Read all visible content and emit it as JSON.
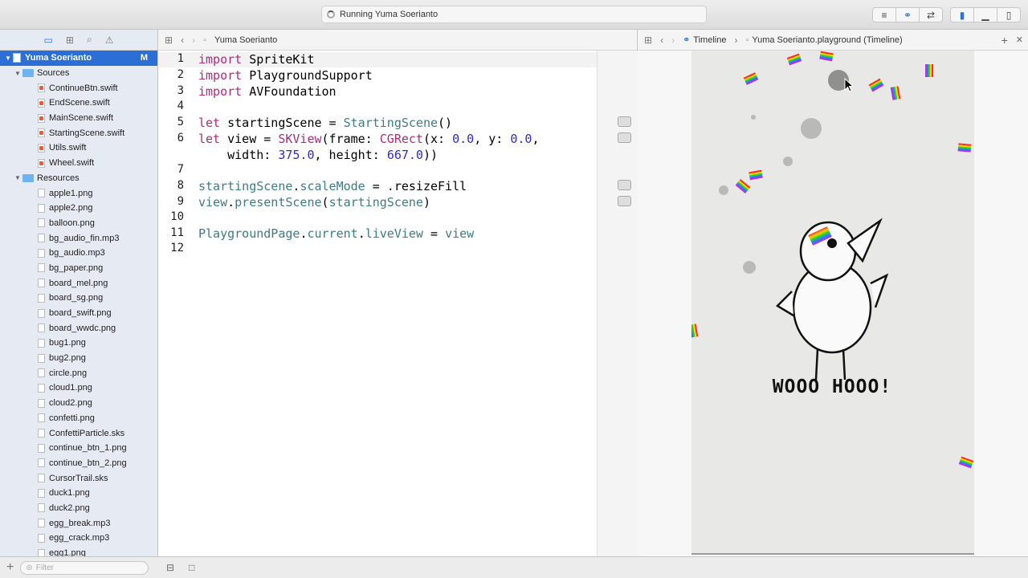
{
  "window": {
    "status": "Running Yuma Soerianto"
  },
  "navigator": {
    "project_name": "Yuma Soerianto",
    "project_badge": "M",
    "groups": [
      {
        "name": "Sources",
        "files": [
          "ContinueBtn.swift",
          "EndScene.swift",
          "MainScene.swift",
          "StartingScene.swift",
          "Utils.swift",
          "Wheel.swift"
        ]
      },
      {
        "name": "Resources",
        "files": [
          "apple1.png",
          "apple2.png",
          "balloon.png",
          "bg_audio_fin.mp3",
          "bg_audio.mp3",
          "bg_paper.png",
          "board_mel.png",
          "board_sg.png",
          "board_swift.png",
          "board_wwdc.png",
          "bug1.png",
          "bug2.png",
          "circle.png",
          "cloud1.png",
          "cloud2.png",
          "confetti.png",
          "ConfettiParticle.sks",
          "continue_btn_1.png",
          "continue_btn_2.png",
          "CursorTrail.sks",
          "duck1.png",
          "duck2.png",
          "egg_break.mp3",
          "egg_crack.mp3",
          "egg1.png"
        ]
      }
    ],
    "filter_placeholder": "Filter"
  },
  "editor": {
    "breadcrumb": "Yuma Soerianto",
    "line_numbers": [
      "1",
      "2",
      "3",
      "4",
      "5",
      "6",
      "",
      "7",
      "8",
      "9",
      "10",
      "11",
      "12"
    ],
    "code": {
      "l1_kw": "import",
      "l1_rest": " SpriteKit",
      "l2_kw": "import",
      "l2_rest": " PlaygroundSupport",
      "l3_kw": "import",
      "l3_rest": " AVFoundation",
      "l5_kw": "let",
      "l5_a": " startingScene = ",
      "l5_ty": "StartingScene",
      "l5_b": "()",
      "l6_kw": "let",
      "l6_a": " view = ",
      "l6_ty1": "SKView",
      "l6_b": "(frame: ",
      "l6_ty2": "CGRect",
      "l6_c": "(x: ",
      "l6_n1": "0.0",
      "l6_d": ", y: ",
      "l6_n2": "0.0",
      "l6_e": ",",
      "l6w_a": "    width: ",
      "l6w_n1": "375.0",
      "l6w_b": ", height: ",
      "l6w_n2": "667.0",
      "l6w_c": "))",
      "l8_ty": "startingScene",
      "l8_a": ".",
      "l8_ty2": "scaleMode",
      "l8_b": " = .",
      "l8_ty3": "resizeFill",
      "l9_ty": "view",
      "l9_a": ".",
      "l9_ty2": "presentScene",
      "l9_b": "(",
      "l9_ty3": "startingScene",
      "l9_c": ")",
      "l11_ty": "PlaygroundPage",
      "l11_a": ".",
      "l11_ty2": "current",
      "l11_b": ".",
      "l11_ty3": "liveView",
      "l11_c": " = ",
      "l11_ty4": "view"
    }
  },
  "assistant": {
    "crumb_timeline": "Timeline",
    "crumb_file": "Yuma Soerianto.playground (Timeline)",
    "live_view_text": "WOOO HOOO!"
  }
}
